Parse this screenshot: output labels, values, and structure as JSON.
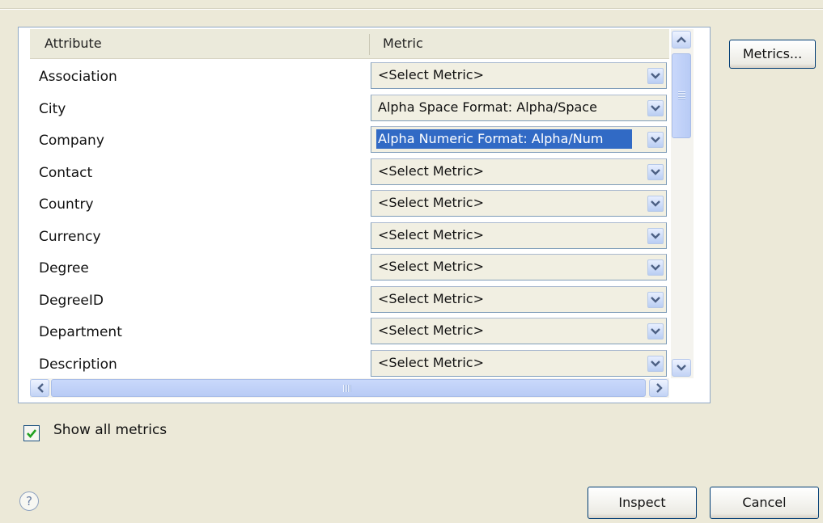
{
  "table": {
    "headers": {
      "attribute": "Attribute",
      "metric": "Metric"
    },
    "rows": [
      {
        "attribute": "Association",
        "metric": "<Select Metric>",
        "selected": false
      },
      {
        "attribute": "City",
        "metric": "Alpha Space Format:  Alpha/Space",
        "selected": false
      },
      {
        "attribute": "Company",
        "metric": "Alpha Numeric Format:  Alpha/Num",
        "selected": true
      },
      {
        "attribute": "Contact",
        "metric": "<Select Metric>",
        "selected": false
      },
      {
        "attribute": "Country",
        "metric": "<Select Metric>",
        "selected": false
      },
      {
        "attribute": "Currency",
        "metric": "<Select Metric>",
        "selected": false
      },
      {
        "attribute": "Degree",
        "metric": "<Select Metric>",
        "selected": false
      },
      {
        "attribute": "DegreeID",
        "metric": "<Select Metric>",
        "selected": false
      },
      {
        "attribute": "Department",
        "metric": "<Select Metric>",
        "selected": false
      },
      {
        "attribute": "Description",
        "metric": "<Select Metric>",
        "selected": false
      }
    ]
  },
  "buttons": {
    "metrics": "Metrics...",
    "inspect": "Inspect",
    "cancel": "Cancel"
  },
  "options": {
    "show_all_metrics_label": "Show all metrics",
    "show_all_metrics_checked": true
  },
  "help": {
    "glyph": "?"
  },
  "icons": {
    "dropdown": "chevron-down-icon",
    "scroll_up": "chevron-up-icon",
    "scroll_down": "chevron-down-icon",
    "scroll_left": "chevron-left-icon",
    "scroll_right": "chevron-right-icon",
    "check": "check-icon",
    "help": "help-icon"
  },
  "colors": {
    "dialog_bg": "#ece9d8",
    "selection": "#316ac5",
    "border": "#7f9db9"
  }
}
